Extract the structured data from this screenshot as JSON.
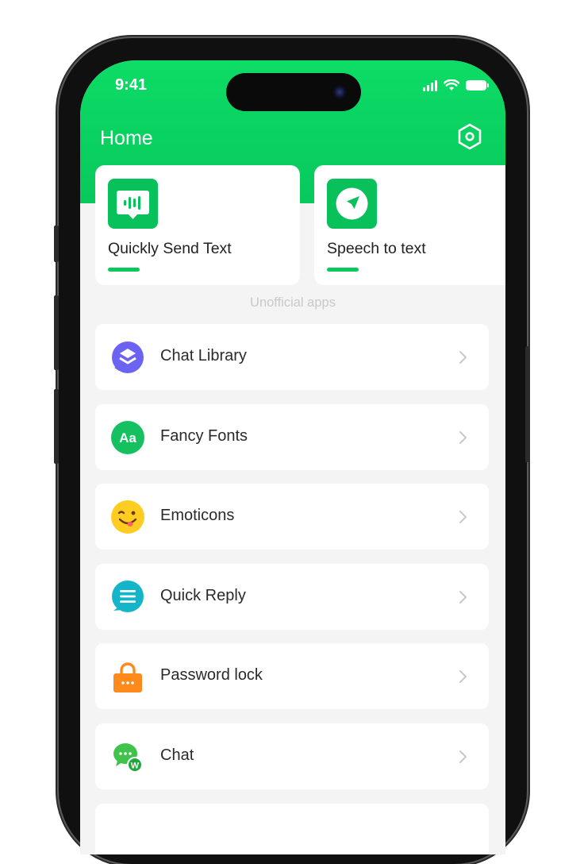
{
  "status_bar": {
    "time": "9:41"
  },
  "header": {
    "title": "Home"
  },
  "top_cards": [
    {
      "label": "Quickly Send Text",
      "icon": "chat-bubble-bars-icon"
    },
    {
      "label": "Speech to text",
      "icon": "send-arrow-icon"
    }
  ],
  "section": {
    "label": "Unofficial apps"
  },
  "list": [
    {
      "label": "Chat Library",
      "icon": "layers-chat-icon",
      "color": "#6d63f2"
    },
    {
      "label": "Fancy Fonts",
      "icon": "font-aa-icon",
      "color": "#15c060"
    },
    {
      "label": "Emoticons",
      "icon": "emoji-icon",
      "color": "#ffcc22"
    },
    {
      "label": "Quick Reply",
      "icon": "reply-list-icon",
      "color": "#14b5c8"
    },
    {
      "label": "Password lock",
      "icon": "lock-icon",
      "color": "#ff8a1c"
    },
    {
      "label": "Chat",
      "icon": "wechat-icon",
      "color": "#3fc34b"
    }
  ],
  "colors": {
    "brand": "#07c55a",
    "background": "#f4f4f4"
  }
}
